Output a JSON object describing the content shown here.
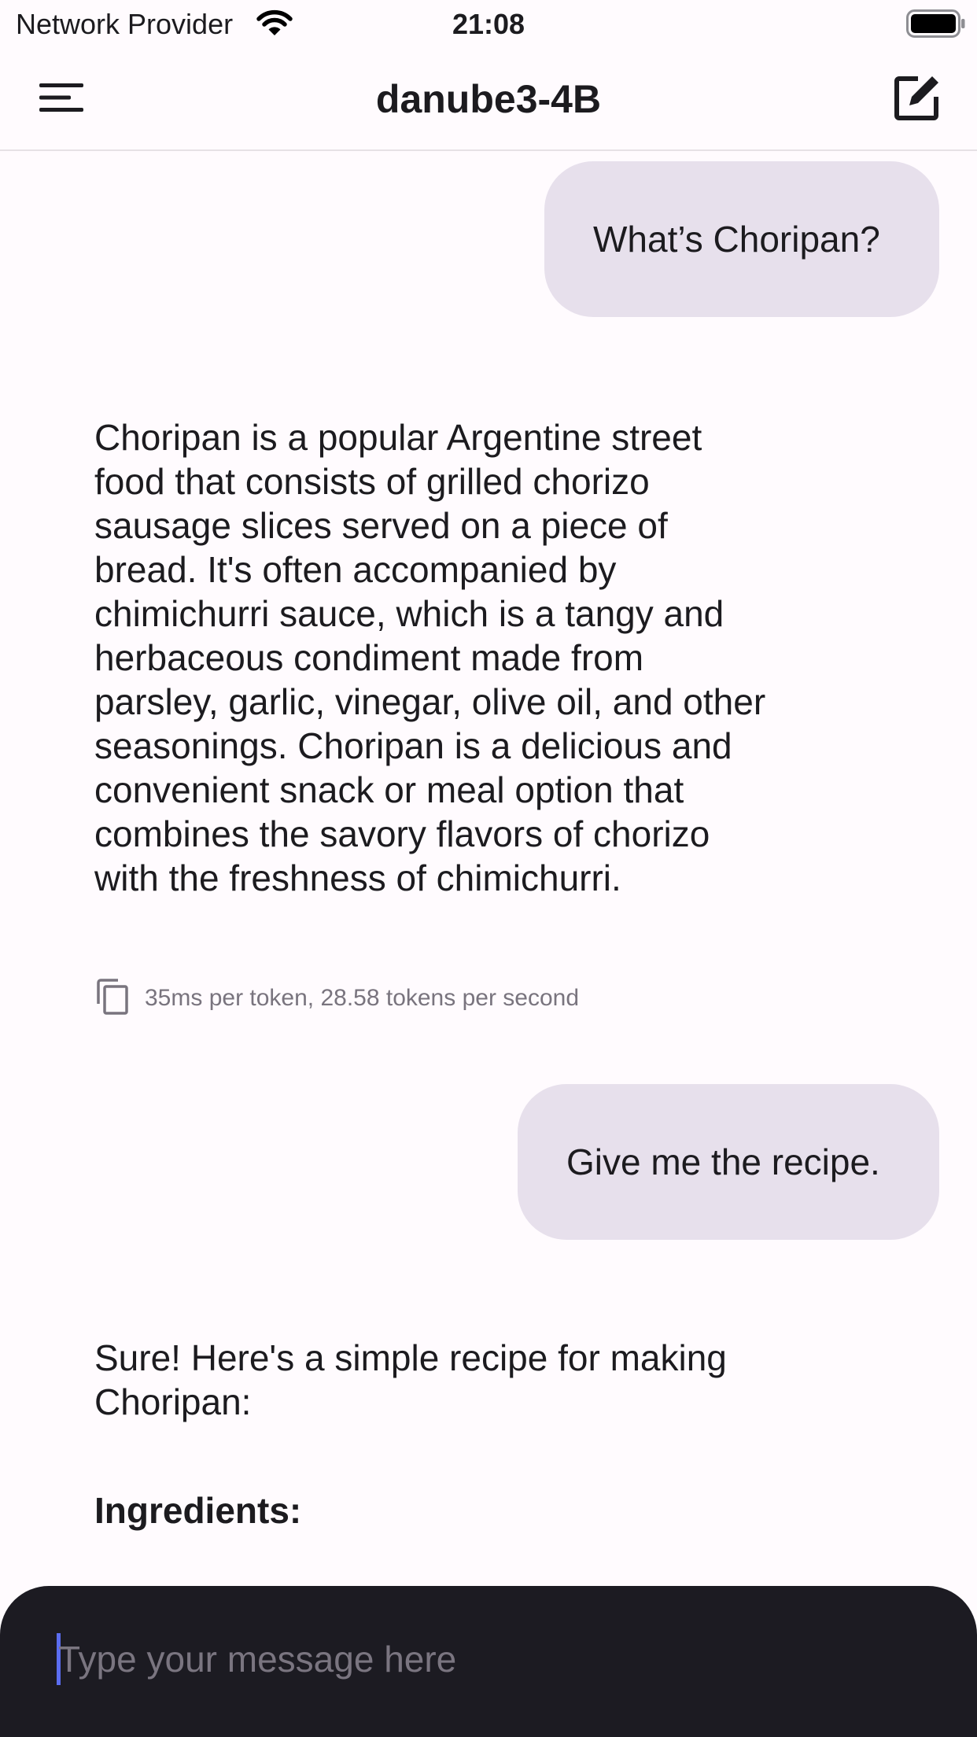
{
  "status_bar": {
    "carrier": "Network Provider",
    "time": "21:08",
    "wifi_icon": "wifi-icon",
    "battery_icon": "battery-icon"
  },
  "app_bar": {
    "title": "danube3-4B",
    "menu_icon": "menu-icon",
    "new_chat_icon": "edit-icon"
  },
  "messages": [
    {
      "role": "user",
      "text": "What’s Choripan?"
    },
    {
      "role": "assistant",
      "text": "Choripan is a popular Argentine street food that consists of grilled chorizo sausage slices served on a piece of bread. It's often accompanied by chimichurri sauce, which is a tangy and herbaceous condiment made from parsley, garlic, vinegar, olive oil, and other seasonings. Choripan is a delicious and convenient snack or meal option that combines the savory flavors of chorizo with the freshness of chimichurri.",
      "stats": "35ms per token, 28.58 tokens per second",
      "copy_icon": "copy-icon"
    },
    {
      "role": "user",
      "text": "Give me the recipe."
    },
    {
      "role": "assistant",
      "text": "Sure! Here's a simple recipe for making Choripan:",
      "heading": "Ingredients:"
    }
  ],
  "composer": {
    "placeholder": "Type your message here",
    "value": ""
  },
  "colors": {
    "background": "#fffbfe",
    "user_bubble": "#e7e0ec",
    "composer": "#1c1b22",
    "caret": "#5b6df0",
    "muted_text": "#79747e"
  }
}
